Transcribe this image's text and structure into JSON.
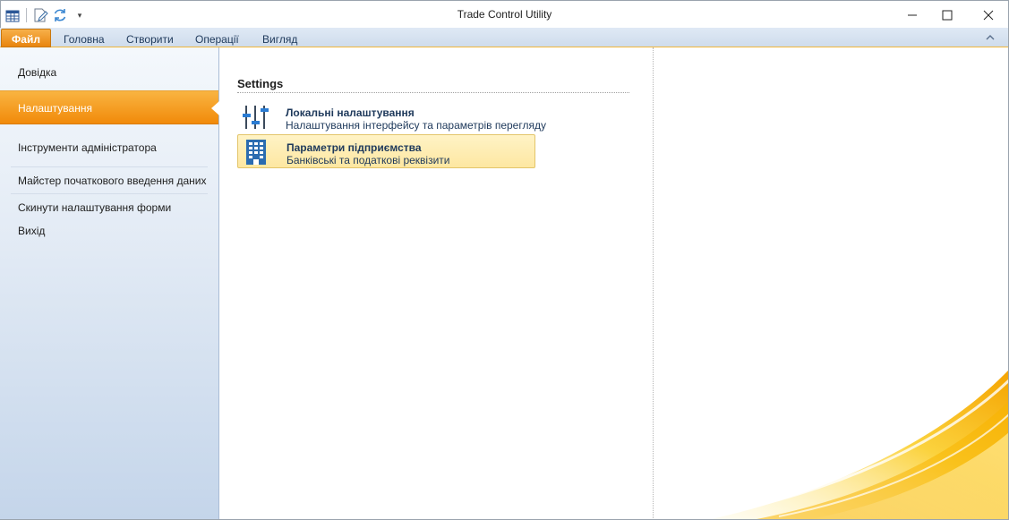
{
  "window": {
    "title": "Trade Control Utility",
    "qat": {
      "overflow_glyph": "▾"
    },
    "minimize_glyph": "—",
    "maximize_glyph": "☐",
    "close_glyph": "✕"
  },
  "ribbon": {
    "tabs": [
      {
        "label": "Файл"
      },
      {
        "label": "Головна"
      },
      {
        "label": "Створити"
      },
      {
        "label": "Операції"
      },
      {
        "label": "Вигляд"
      }
    ],
    "collapse_glyph": "⌃"
  },
  "backstage": {
    "nav": [
      {
        "label": "Довідка"
      },
      {
        "label": "Налаштування",
        "selected": true
      },
      {
        "label": "Інструменти адміністратора"
      },
      {
        "label": "Майстер початкового введення даних"
      },
      {
        "label": "Скинути налаштування форми"
      },
      {
        "label": "Вихід"
      }
    ],
    "section_title": "Settings",
    "options": [
      {
        "title": "Локальні налаштування",
        "description": "Налаштування інтерфейсу та параметрів перегляду",
        "icon": "sliders-icon"
      },
      {
        "title": "Параметри підприємства",
        "description": "Банківські та податкові реквізити",
        "icon": "building-icon",
        "highlighted": true
      }
    ]
  },
  "colors": {
    "accent_orange": "#f18a0a",
    "ribbon_blue": "#d6e3f2",
    "text_blue": "#1e395b",
    "highlight_yellow": "#fde7a1"
  }
}
